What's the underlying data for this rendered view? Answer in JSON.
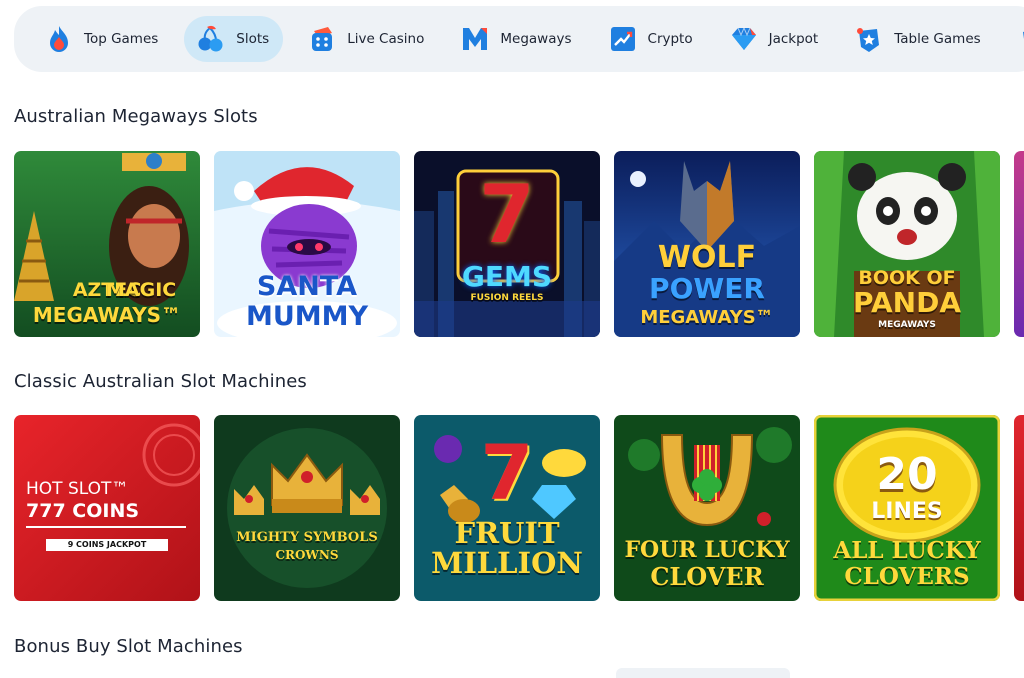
{
  "nav": {
    "items": [
      {
        "label": "Top Games",
        "icon": "flame-icon"
      },
      {
        "label": "Slots",
        "icon": "cherries-icon",
        "active": true
      },
      {
        "label": "Live Casino",
        "icon": "dice-icon"
      },
      {
        "label": "Megaways",
        "icon": "megaways-m-icon"
      },
      {
        "label": "Crypto",
        "icon": "crypto-chart-icon"
      },
      {
        "label": "Jackpot",
        "icon": "diamond-icon"
      },
      {
        "label": "Table Games",
        "icon": "card-star-icon"
      }
    ]
  },
  "sections": [
    {
      "title": "Australian Megaways Slots",
      "games": [
        {
          "title_lines": [
            "AZTEC",
            "MAGIC",
            "MEGAWAYS™"
          ]
        },
        {
          "title_lines": [
            "SANTA",
            "MUMMY"
          ]
        },
        {
          "title_lines": [
            "7",
            "GEMS",
            "FUSION REELS"
          ]
        },
        {
          "title_lines": [
            "WOLF",
            "POWER",
            "MEGAWAYS™"
          ]
        },
        {
          "title_lines": [
            "BOOK OF",
            "PANDA",
            "MEGAWAYS"
          ]
        }
      ]
    },
    {
      "title": "Classic Australian Slot Machines",
      "games": [
        {
          "title_lines": [
            "HOT SLOT™",
            "777 COINS",
            "9 COINS JACKPOT"
          ]
        },
        {
          "title_lines": [
            "MIGHTY SYMBOLS",
            "CROWNS"
          ]
        },
        {
          "title_lines": [
            "7",
            "FRUIT",
            "MILLION"
          ]
        },
        {
          "title_lines": [
            "FOUR LUCKY",
            "CLOVER"
          ]
        },
        {
          "title_lines": [
            "20",
            "LINES",
            "ALL LUCKY",
            "CLOVERS"
          ]
        }
      ]
    },
    {
      "title": "Bonus Buy Slot Machines",
      "games": []
    }
  ],
  "colors": {
    "nav_bg": "#eef2f6",
    "nav_active": "#cfe8f7",
    "text": "#1d2433",
    "accent_blue": "#1f7fe0"
  }
}
